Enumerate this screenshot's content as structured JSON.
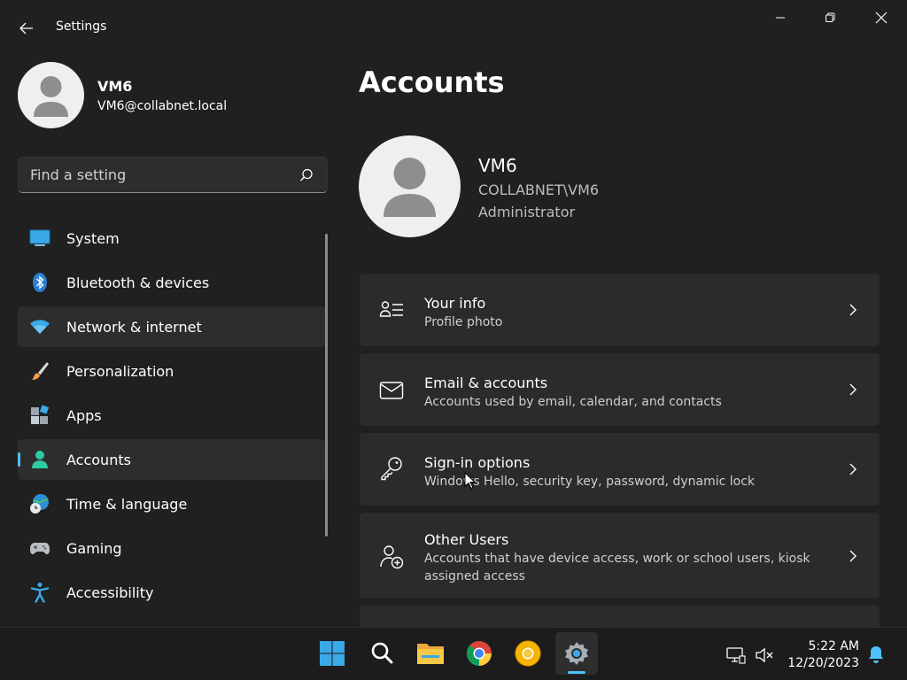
{
  "window": {
    "title": "Settings"
  },
  "profile": {
    "name": "VM6",
    "email": "VM6@collabnet.local"
  },
  "search": {
    "placeholder": "Find a setting"
  },
  "nav": {
    "items": [
      {
        "label": "System",
        "icon": "system-icon"
      },
      {
        "label": "Bluetooth & devices",
        "icon": "bluetooth-icon"
      },
      {
        "label": "Network & internet",
        "icon": "wifi-icon"
      },
      {
        "label": "Personalization",
        "icon": "brush-icon"
      },
      {
        "label": "Apps",
        "icon": "apps-icon"
      },
      {
        "label": "Accounts",
        "icon": "person-icon"
      },
      {
        "label": "Time & language",
        "icon": "globe-clock-icon"
      },
      {
        "label": "Gaming",
        "icon": "gamepad-icon"
      },
      {
        "label": "Accessibility",
        "icon": "accessibility-icon"
      }
    ],
    "selected": "Accounts",
    "hovered": "Network & internet"
  },
  "main": {
    "title": "Accounts",
    "account": {
      "name": "VM6",
      "domain": "COLLABNET\\VM6",
      "role": "Administrator"
    },
    "cards": [
      {
        "title": "Your info",
        "subtitle": "Profile photo",
        "icon": "user-info-icon"
      },
      {
        "title": "Email & accounts",
        "subtitle": "Accounts used by email, calendar, and contacts",
        "icon": "mail-icon"
      },
      {
        "title": "Sign-in options",
        "subtitle": "Windows Hello, security key, password, dynamic lock",
        "icon": "key-icon"
      },
      {
        "title": "Other Users",
        "subtitle": "Accounts that have device access, work or school users, kiosk assigned access",
        "icon": "person-add-icon"
      }
    ]
  },
  "taskbar": {
    "apps": [
      "start-icon",
      "search-icon",
      "file-explorer-icon",
      "chrome-icon",
      "chrome-canary-icon",
      "settings-icon"
    ],
    "active_app": "settings-icon",
    "time": "5:22 AM",
    "date": "12/20/2023"
  },
  "colors": {
    "accent": "#4cc2ff",
    "background": "#202020",
    "card": "#2b2b2b"
  }
}
